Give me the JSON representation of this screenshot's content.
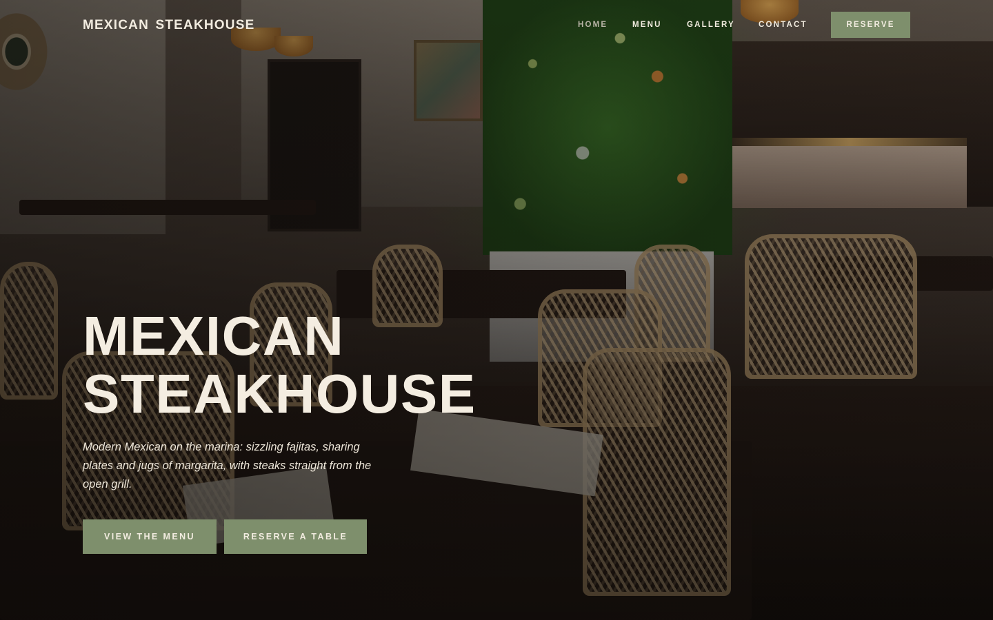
{
  "header": {
    "brand": "MEXICAN  STEAKHOUSE",
    "nav": [
      {
        "label": "HOME",
        "active": true
      },
      {
        "label": "MENU",
        "active": false
      },
      {
        "label": "GALLERY",
        "active": false
      },
      {
        "label": "CONTACT",
        "active": false
      }
    ],
    "reserve_label": "RESERVE"
  },
  "hero": {
    "title_line1": "MEXICAN",
    "title_line2": "STEAKHOUSE",
    "subtitle": "Modern Mexican on the marina: sizzling fajitas, sharing plates and jugs of margarita, with steaks straight from the open grill.",
    "primary_cta": "VIEW THE MENU",
    "secondary_cta": "RESERVE A TABLE"
  },
  "colors": {
    "accent": "#7e8f6c",
    "text_light": "#f4ede1",
    "nav_active": "#b8b3a6"
  }
}
